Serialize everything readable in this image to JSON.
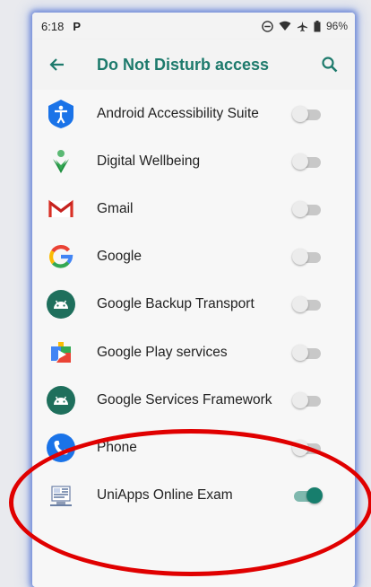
{
  "status": {
    "time": "6:18",
    "battery": "96%"
  },
  "app_bar": {
    "title": "Do Not Disturb access"
  },
  "apps": [
    {
      "name": "Android Accessibility Suite",
      "enabled": false,
      "icon": "accessibility-icon"
    },
    {
      "name": "Digital Wellbeing",
      "enabled": false,
      "icon": "wellbeing-icon"
    },
    {
      "name": "Gmail",
      "enabled": false,
      "icon": "gmail-icon"
    },
    {
      "name": "Google",
      "enabled": false,
      "icon": "google-icon"
    },
    {
      "name": "Google Backup Transport",
      "enabled": false,
      "icon": "android-icon"
    },
    {
      "name": "Google Play services",
      "enabled": false,
      "icon": "play-services-icon"
    },
    {
      "name": "Google Services Framework",
      "enabled": false,
      "icon": "android-icon"
    },
    {
      "name": "Phone",
      "enabled": false,
      "icon": "phone-icon"
    },
    {
      "name": "UniApps Online Exam",
      "enabled": true,
      "icon": "uniapps-icon"
    }
  ],
  "colors": {
    "accent": "#1d7a6c",
    "highlight": "#e00000"
  }
}
